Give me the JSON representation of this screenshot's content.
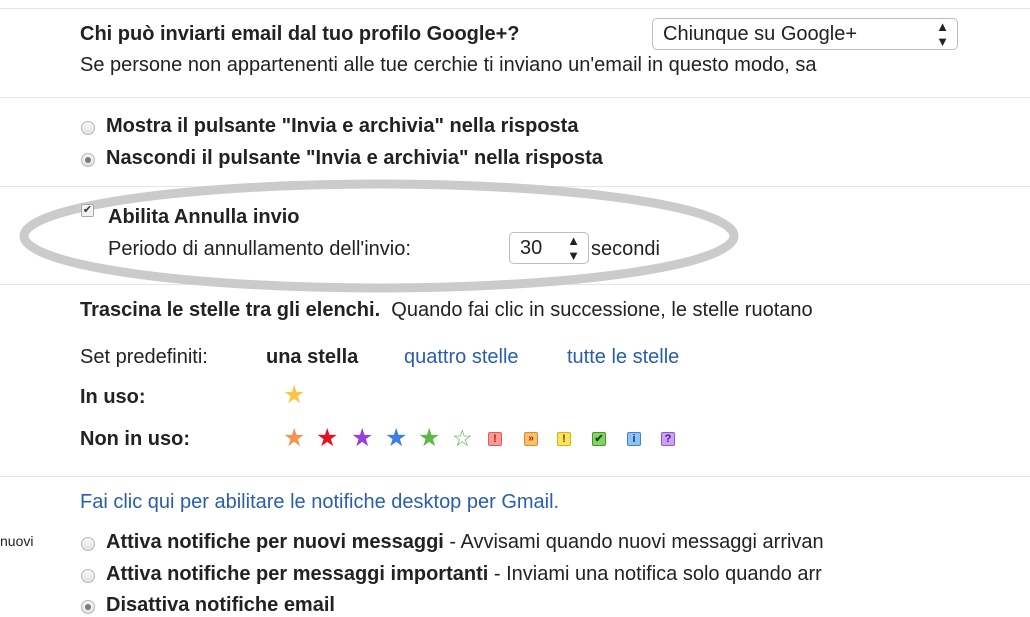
{
  "gplus": {
    "question": "Chi può inviarti email dal tuo profilo Google+?",
    "select_value": "Chiunque su Google+",
    "note": "Se persone non appartenenti alle tue cerchie ti inviano un'email in questo modo, sa"
  },
  "send_archive": {
    "show_label": "Mostra il pulsante \"Invia e archivia\" nella risposta",
    "hide_label": "Nascondi il pulsante \"Invia e archivia\" nella risposta"
  },
  "undo_send": {
    "enable_label": "Abilita Annulla invio",
    "period_label": "Periodo di annullamento dell'invio:",
    "period_value": "30",
    "unit": "secondi"
  },
  "stars": {
    "drag_bold": "Trascina le stelle tra gli elenchi.",
    "drag_rest": "Quando fai clic in successione, le stelle ruotano",
    "presets_label": "Set predefiniti:",
    "preset_one": "una stella",
    "preset_four": "quattro stelle",
    "preset_all": "tutte le stelle",
    "in_use_label": "In uso:",
    "not_in_use_label": "Non in uso:"
  },
  "notifications": {
    "enable_link": "Fai clic qui per abilitare le notifiche desktop per Gmail.",
    "left_label": "nuovi",
    "opt1_bold": "Attiva notifiche per nuovi messaggi",
    "opt1_rest": " - Avvisami quando nuovi messaggi arrivan",
    "opt2_bold": "Attiva notifiche per messaggi importanti",
    "opt2_rest": " - Inviami una notifica solo quando arr",
    "opt3_bold": "Disattiva notifiche email"
  }
}
